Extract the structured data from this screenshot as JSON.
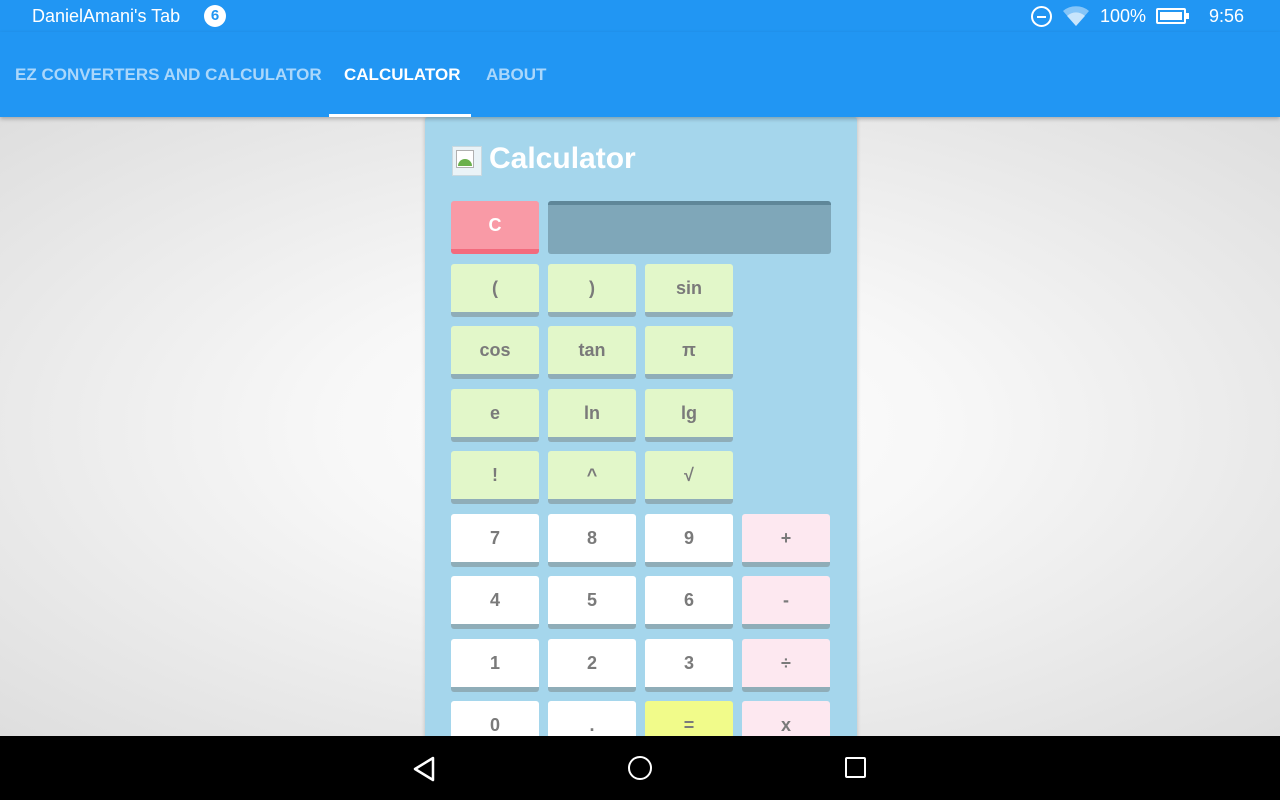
{
  "status_bar": {
    "title": "DanielAmani's Tab",
    "notification_count": "6",
    "battery": "100%",
    "time": "9:56"
  },
  "tabs": [
    {
      "label": "EZ  CONVERTERS AND CALCULATOR",
      "active": false
    },
    {
      "label": "CALCULATOR",
      "active": true
    },
    {
      "label": "ABOUT",
      "active": false
    }
  ],
  "calculator": {
    "title": "Calculator",
    "display_value": "",
    "clear_label": "C",
    "function_rows": [
      [
        "(",
        ")",
        "sin"
      ],
      [
        "cos",
        "tan",
        "π"
      ],
      [
        "e",
        "ln",
        "lg"
      ],
      [
        "!",
        "^",
        "√"
      ]
    ],
    "number_rows": [
      [
        "7",
        "8",
        "9",
        "+"
      ],
      [
        "4",
        "5",
        "6",
        "-"
      ],
      [
        "1",
        "2",
        "3",
        "÷"
      ],
      [
        "0",
        ".",
        "=",
        "x"
      ]
    ]
  },
  "colors": {
    "app_bar": "#2196f3",
    "calculator_panel": "#a5d6ec",
    "function_key": "#e2f7c9",
    "operator_key": "#fde8f0",
    "equals_key": "#f1fb8a",
    "clear_key": "#f99aa6"
  },
  "icons": {
    "status": [
      "do-not-disturb-icon",
      "wifi-icon",
      "battery-icon"
    ],
    "navigation": [
      "back-icon",
      "home-icon",
      "recents-icon"
    ],
    "calculator_header": "broken-image-icon"
  }
}
